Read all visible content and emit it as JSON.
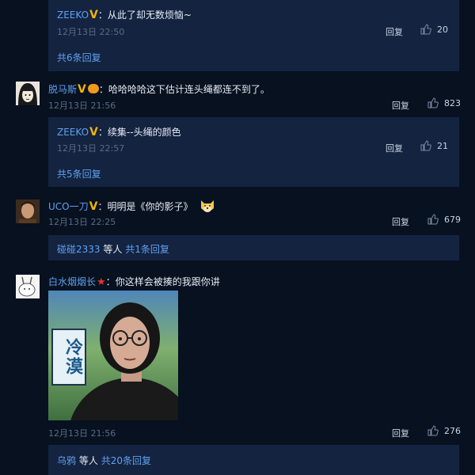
{
  "r1": {
    "name": "ZEEKO",
    "text": "从此了却无数烦恼~",
    "time": "12月13日 22:50",
    "reply": "回复",
    "likes": "20",
    "total": "共6条回复"
  },
  "c1": {
    "name": "脱马斯",
    "text": "哈哈哈哈这下估计连头绳都连不到了。",
    "time": "12月13日 21:56",
    "reply": "回复",
    "likes": "823"
  },
  "r2": {
    "name": "ZEEKO",
    "text": "续集--头绳的颜色",
    "time": "12月13日 22:57",
    "reply": "回复",
    "likes": "21",
    "total": "共5条回复"
  },
  "c2": {
    "name": "UCO一刀",
    "text": "明明是《你的影子》",
    "time": "12月13日 22:25",
    "reply": "回复",
    "likes": "679",
    "sub_user": "碰碰2333",
    "sub_mid": "等人",
    "sub_total": "共1条回复"
  },
  "c3": {
    "name": "白水烟烟长",
    "text": "你这样会被揍的我跟你讲",
    "image_text": "冷漠",
    "time": "12月13日 21:56",
    "reply": "回复",
    "likes": "276",
    "sub_user": "乌鸦",
    "sub_mid": "等人",
    "sub_total": "共20条回复"
  },
  "colors": {
    "accent": "#5fa0ef",
    "bg": "#071120",
    "box": "#142340",
    "vip": "#f2b500"
  },
  "icons": [
    "thumbs-up-icon",
    "vip-v-icon",
    "star-icon",
    "doge-emoji",
    "sticker-icon"
  ]
}
